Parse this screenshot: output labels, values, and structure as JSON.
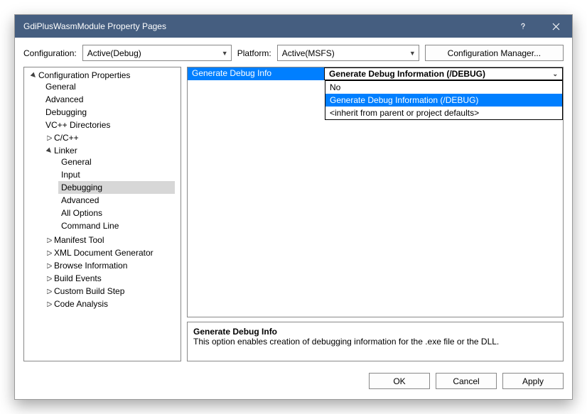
{
  "window": {
    "title": "GdiPlusWasmModule Property Pages"
  },
  "toprow": {
    "config_label": "Configuration:",
    "config_value": "Active(Debug)",
    "platform_label": "Platform:",
    "platform_value": "Active(MSFS)",
    "cfgmgr": "Configuration Manager..."
  },
  "tree": {
    "root": "Configuration Properties",
    "items": [
      "General",
      "Advanced",
      "Debugging",
      "VC++ Directories"
    ],
    "cpp": "C/C++",
    "linker": "Linker",
    "linker_children": [
      "General",
      "Input",
      "Debugging",
      "Advanced",
      "All Options",
      "Command Line"
    ],
    "tail": [
      "Manifest Tool",
      "XML Document Generator",
      "Browse Information",
      "Build Events",
      "Custom Build Step",
      "Code Analysis"
    ]
  },
  "grid": {
    "prop": "Generate Debug Info",
    "value": "Generate Debug Information (/DEBUG)"
  },
  "dropdown": {
    "opt0": "No",
    "opt1": "Generate Debug Information (/DEBUG)",
    "opt2": "<inherit from parent or project defaults>"
  },
  "desc": {
    "title": "Generate Debug Info",
    "text": "This option enables creation of debugging information for the .exe file or the DLL."
  },
  "footer": {
    "ok": "OK",
    "cancel": "Cancel",
    "apply": "Apply"
  }
}
